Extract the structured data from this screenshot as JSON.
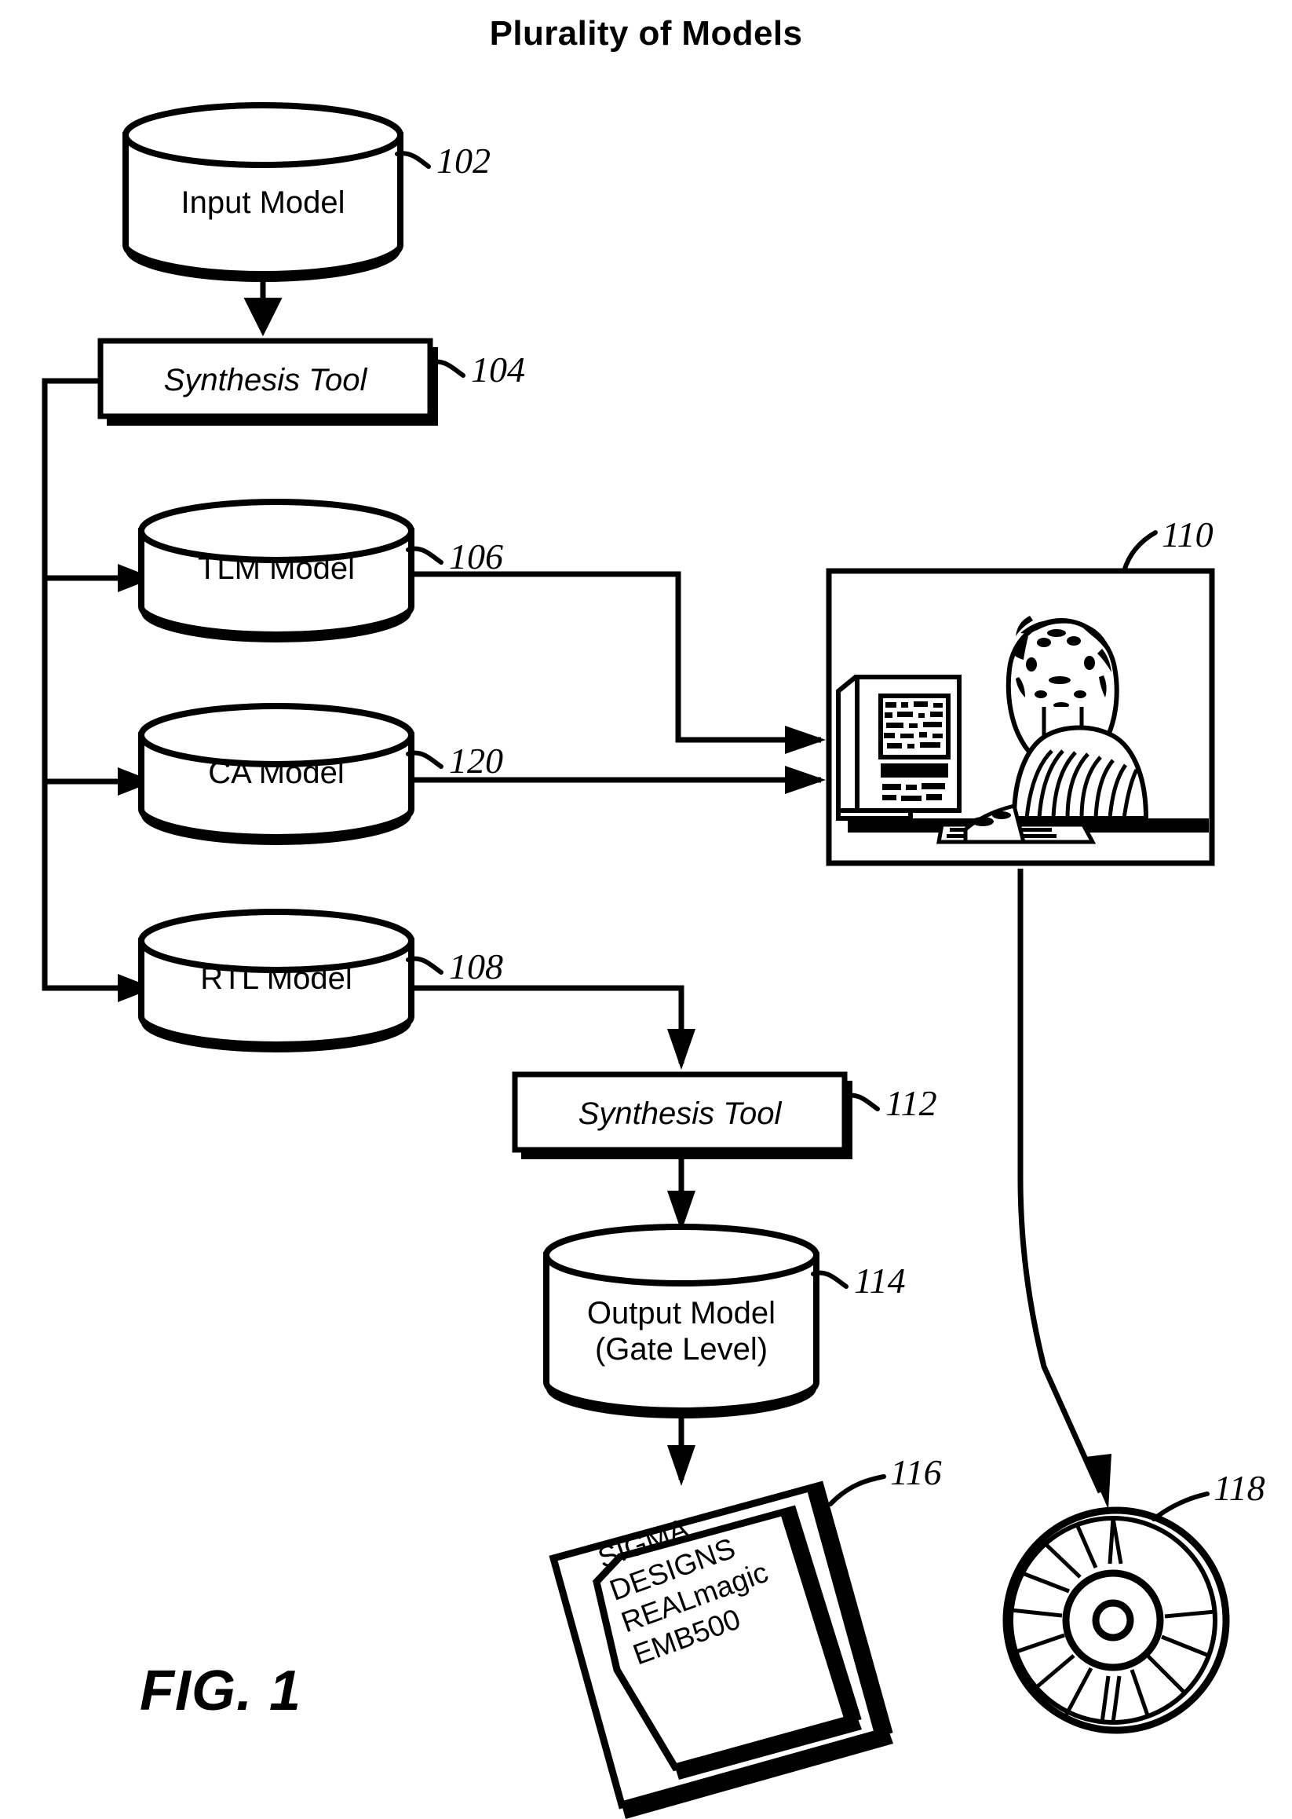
{
  "figure": {
    "title": "Plurality of Models",
    "caption": "FIG. 1"
  },
  "nodes": {
    "input_model": {
      "label": "Input Model",
      "ref": "102",
      "shape": "cylinder"
    },
    "synthesis_tool_top": {
      "label": "Synthesis Tool",
      "ref": "104",
      "shape": "process-box"
    },
    "tlm_model": {
      "label": "TLM Model",
      "ref": "106",
      "shape": "cylinder"
    },
    "ca_model": {
      "label": "CA Model",
      "ref": "120",
      "shape": "cylinder"
    },
    "rtl_model": {
      "label": "RTL Model",
      "ref": "108",
      "shape": "cylinder"
    },
    "workstation": {
      "ref": "110",
      "shape": "image-frame",
      "description": "person-at-computer-image"
    },
    "synthesis_tool_bottom": {
      "label": "Synthesis Tool",
      "ref": "112",
      "shape": "process-box"
    },
    "output_model": {
      "label_line1": "Output Model",
      "label_line2": "(Gate Level)",
      "ref": "114",
      "shape": "cylinder"
    },
    "chip": {
      "ref": "116",
      "shape": "integrated-circuit",
      "lines": [
        "SIGMA",
        "DESIGNS",
        "REALmagic",
        "EMB500"
      ]
    },
    "disc": {
      "ref": "118",
      "shape": "optical-disc"
    }
  },
  "colors": {
    "stroke": "#000000",
    "background": "#ffffff"
  }
}
